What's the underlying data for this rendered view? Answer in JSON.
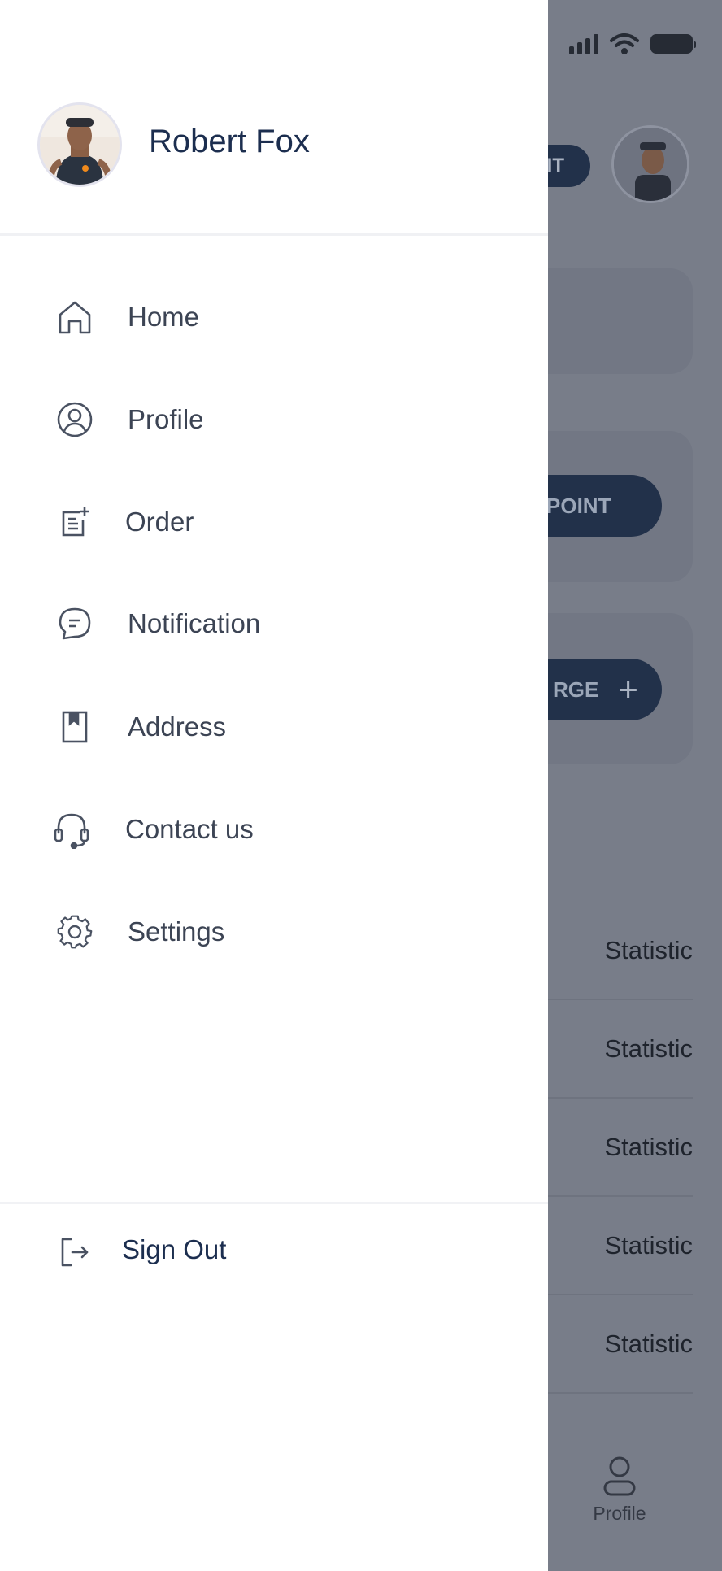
{
  "drawer": {
    "user_name": "Robert Fox",
    "menu": [
      {
        "label": "Home",
        "icon": "home-icon"
      },
      {
        "label": "Profile",
        "icon": "profile-icon"
      },
      {
        "label": "Order",
        "icon": "order-icon"
      },
      {
        "label": "Notification",
        "icon": "chat-icon"
      },
      {
        "label": "Address",
        "icon": "bookmark-icon"
      },
      {
        "label": "Contact us",
        "icon": "headset-icon"
      },
      {
        "label": "Settings",
        "icon": "gear-icon"
      }
    ],
    "sign_out": {
      "label": "Sign Out",
      "icon": "sign-out-icon"
    }
  },
  "background": {
    "top_pill_text": "IT",
    "point_button": "POINT",
    "charge_button": "RGE",
    "rows": [
      "Statistic",
      "Statistic",
      "Statistic",
      "Statistic",
      "Statistic"
    ],
    "tab_profile_label": "Profile"
  },
  "colors": {
    "accent_navy": "#22314a",
    "text_dark": "#1c2e4f",
    "overlay": "#787d89"
  }
}
